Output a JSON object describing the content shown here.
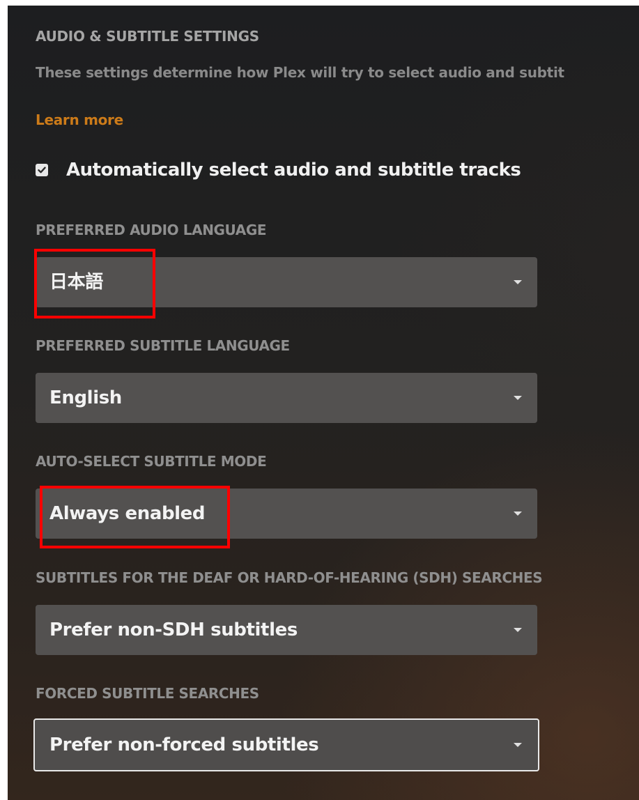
{
  "section": {
    "title": "AUDIO & SUBTITLE SETTINGS",
    "description": "These settings determine how Plex will try to select audio and subtit",
    "learn_more": "Learn more"
  },
  "auto_select": {
    "label": "Automatically select audio and subtitle tracks",
    "checked": true
  },
  "fields": {
    "audio_language": {
      "label": "PREFERRED AUDIO LANGUAGE",
      "value": "日本語"
    },
    "subtitle_language": {
      "label": "PREFERRED SUBTITLE LANGUAGE",
      "value": "English"
    },
    "subtitle_mode": {
      "label": "AUTO-SELECT SUBTITLE MODE",
      "value": "Always enabled"
    },
    "sdh_searches": {
      "label": "SUBTITLES FOR THE DEAF OR HARD-OF-HEARING (SDH) SEARCHES",
      "value": "Prefer non-SDH subtitles"
    },
    "forced_searches": {
      "label": "FORCED SUBTITLE SEARCHES",
      "value": "Prefer non-forced subtitles"
    }
  },
  "colors": {
    "accent": "#cc7b19",
    "highlight": "#ff0000",
    "select_bg": "#535150"
  }
}
